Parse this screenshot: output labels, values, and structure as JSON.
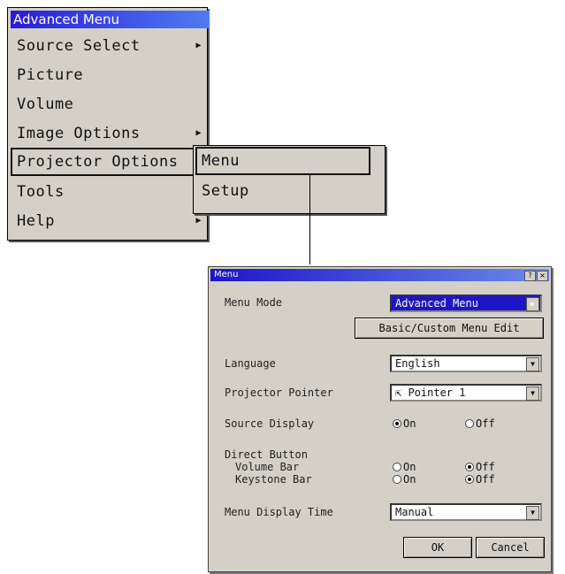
{
  "main_menu": {
    "title": "Advanced Menu",
    "items": [
      {
        "label": "Source Select",
        "arrow": "▶"
      },
      {
        "label": "Picture",
        "arrow": ""
      },
      {
        "label": "Volume",
        "arrow": ""
      },
      {
        "label": "Image Options",
        "arrow": "▶"
      },
      {
        "label": "Projector Options",
        "arrow": "▶"
      },
      {
        "label": "Tools",
        "arrow": "▶"
      },
      {
        "label": "Help",
        "arrow": "▶"
      }
    ]
  },
  "sub_menu": {
    "items": [
      {
        "label": "Menu"
      },
      {
        "label": "Setup"
      }
    ]
  },
  "dialog": {
    "title": "Menu",
    "help_glyph": "?",
    "close_glyph": "×",
    "menu_mode_label": "Menu Mode",
    "menu_mode_value": "Advanced Menu",
    "basic_custom_button": "Basic/Custom Menu Edit",
    "language_label": "Language",
    "language_value": "English",
    "pointer_label": "Projector Pointer",
    "pointer_value": "Pointer 1",
    "source_display_label": "Source Display",
    "on_label": "On",
    "off_label": "Off",
    "direct_button_label": "Direct Button",
    "volume_bar_label": "Volume Bar",
    "keystone_bar_label": "Keystone Bar",
    "menu_display_time_label": "Menu Display Time",
    "menu_display_time_value": "Manual",
    "ok_button": "OK",
    "cancel_button": "Cancel"
  }
}
